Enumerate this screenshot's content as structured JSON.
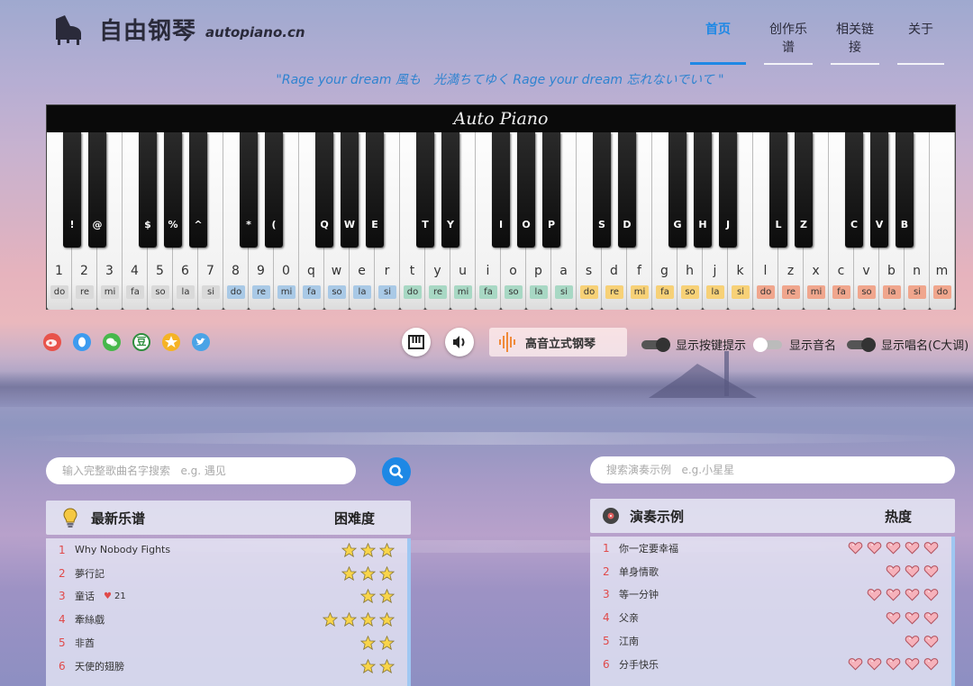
{
  "header": {
    "brand": "自由钢琴",
    "domain": "autopiano.cn",
    "nav": [
      "首页",
      "创作乐谱",
      "相关链接",
      "关于"
    ]
  },
  "quote": "\"Rage your dream 風も　光満ちてゆく Rage your dream 忘れないでいて \"",
  "piano": {
    "title": "Auto Piano",
    "white_keys": [
      {
        "c": "1",
        "n": "do"
      },
      {
        "c": "2",
        "n": "re"
      },
      {
        "c": "3",
        "n": "mi"
      },
      {
        "c": "4",
        "n": "fa"
      },
      {
        "c": "5",
        "n": "so"
      },
      {
        "c": "6",
        "n": "la"
      },
      {
        "c": "7",
        "n": "si"
      },
      {
        "c": "8",
        "n": "do"
      },
      {
        "c": "9",
        "n": "re"
      },
      {
        "c": "0",
        "n": "mi"
      },
      {
        "c": "q",
        "n": "fa"
      },
      {
        "c": "w",
        "n": "so"
      },
      {
        "c": "e",
        "n": "la"
      },
      {
        "c": "r",
        "n": "si"
      },
      {
        "c": "t",
        "n": "do"
      },
      {
        "c": "y",
        "n": "re"
      },
      {
        "c": "u",
        "n": "mi"
      },
      {
        "c": "i",
        "n": "fa"
      },
      {
        "c": "o",
        "n": "so"
      },
      {
        "c": "p",
        "n": "la"
      },
      {
        "c": "a",
        "n": "si"
      },
      {
        "c": "s",
        "n": "do"
      },
      {
        "c": "d",
        "n": "re"
      },
      {
        "c": "f",
        "n": "mi"
      },
      {
        "c": "g",
        "n": "fa"
      },
      {
        "c": "h",
        "n": "so"
      },
      {
        "c": "j",
        "n": "la"
      },
      {
        "c": "k",
        "n": "si"
      },
      {
        "c": "l",
        "n": "do"
      },
      {
        "c": "z",
        "n": "re"
      },
      {
        "c": "x",
        "n": "mi"
      },
      {
        "c": "c",
        "n": "fa"
      },
      {
        "c": "v",
        "n": "so"
      },
      {
        "c": "b",
        "n": "la"
      },
      {
        "c": "n",
        "n": "si"
      },
      {
        "c": "m",
        "n": "do"
      }
    ],
    "black_keys": [
      "!",
      "@",
      "$",
      "%",
      "^",
      "*",
      "(",
      "Q",
      "W",
      "E",
      "T",
      "Y",
      "I",
      "O",
      "P",
      "S",
      "D",
      "G",
      "H",
      "J",
      "L",
      "Z",
      "C",
      "V",
      "B"
    ],
    "note_colors": [
      "#d9d9d9",
      "#a9c9e6",
      "#a8d8c4",
      "#f7d177",
      "#f0a68d"
    ]
  },
  "controls": {
    "instrument": "高音立式钢琴",
    "toggle1": "显示按键提示",
    "toggle2": "显示音名",
    "toggle3": "显示唱名(C大调)",
    "social_icons": [
      "weibo-icon",
      "qq-icon",
      "wechat-icon",
      "douban-icon",
      "star-icon",
      "twitter-icon"
    ],
    "social_douban": "豆"
  },
  "search": {
    "score_placeholder": "输入完整歌曲名字搜索   e.g. 遇见",
    "demo_placeholder": "搜索演奏示例   e.g.小星星"
  },
  "scores": {
    "title": "最新乐谱",
    "rating_header": "困难度",
    "items": [
      {
        "num": "1",
        "name": "Why Nobody Fights",
        "stars": 3
      },
      {
        "num": "2",
        "name": "夢行記",
        "stars": 3
      },
      {
        "num": "3",
        "name": "童话",
        "likes": "21",
        "stars": 2
      },
      {
        "num": "4",
        "name": "牽絲戲",
        "stars": 4
      },
      {
        "num": "5",
        "name": "非酋",
        "stars": 2
      },
      {
        "num": "6",
        "name": "天使的翅膀",
        "stars": 2
      }
    ]
  },
  "demos": {
    "title": "演奏示例",
    "rating_header": "热度",
    "items": [
      {
        "num": "1",
        "name": "你一定要幸福",
        "hearts": 5
      },
      {
        "num": "2",
        "name": "单身情歌",
        "hearts": 3
      },
      {
        "num": "3",
        "name": "等一分钟",
        "hearts": 4
      },
      {
        "num": "4",
        "name": "父亲",
        "hearts": 3
      },
      {
        "num": "5",
        "name": "江南",
        "hearts": 2
      },
      {
        "num": "6",
        "name": "分手快乐",
        "hearts": 5
      }
    ]
  }
}
